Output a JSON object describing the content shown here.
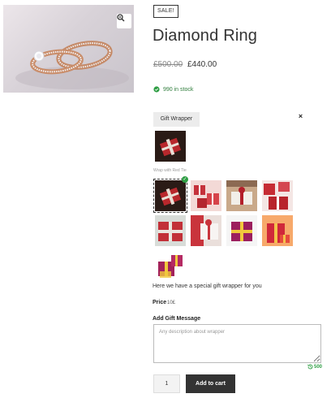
{
  "product": {
    "sale_badge": "SALE!",
    "title": "Diamond Ring",
    "price_old": "£500.00",
    "price_new": "£440.00",
    "stock": "990 in stock"
  },
  "gift": {
    "button_label": "Gift Wrapper",
    "close_symbol": "×",
    "selected_label": "Wrap with Red Tie",
    "check_symbol": "✓",
    "description": "Here we have a special gift wrapper for you",
    "price_label": "Price",
    "price_value": "10£",
    "message_label": "Add Gift Message",
    "message_placeholder": "Any description about wrapper",
    "char_count": "500"
  },
  "cart": {
    "quantity": "1",
    "add_label": "Add to cart"
  },
  "icons": {
    "zoom": "magnifier-icon",
    "stock": "check-circle-icon",
    "close": "close-icon",
    "counter": "history-icon"
  },
  "colors": {
    "accent_green": "#2f9e44",
    "button_dark": "#333333"
  }
}
